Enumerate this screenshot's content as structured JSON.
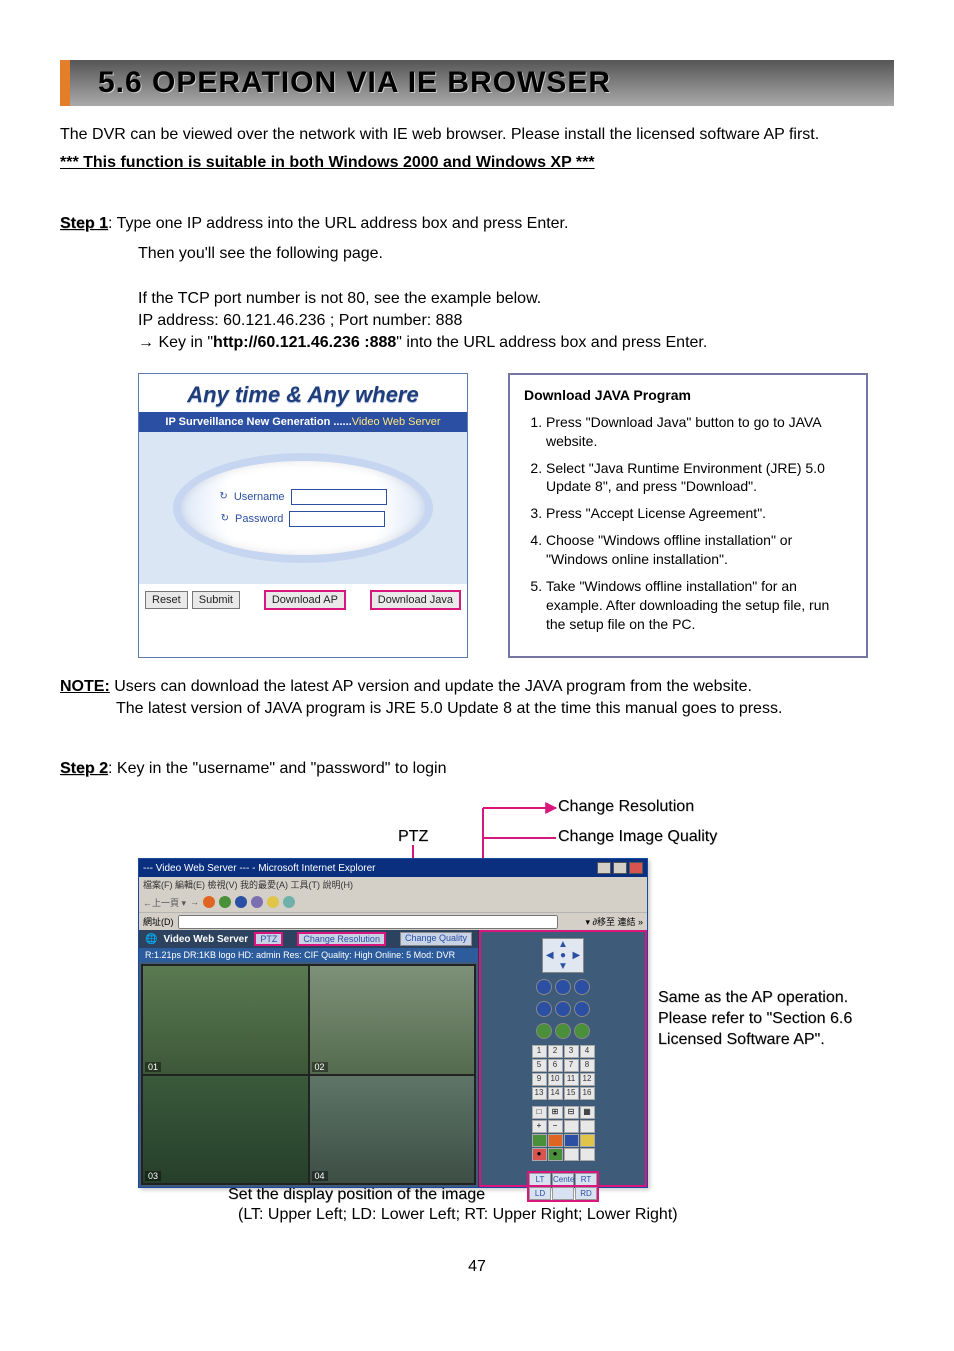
{
  "section": {
    "title": "5.6 OPERATION VIA IE BROWSER",
    "page_number": "47"
  },
  "intro": {
    "line1": "The DVR can be viewed over the network with IE web browser. Please install the licensed software AP first.",
    "bold_note": "*** This function is suitable in both Windows 2000 and Windows XP ***"
  },
  "step1": {
    "label": "Step 1",
    "body_rest": ": Type one IP address into the URL address box and press Enter.",
    "line2": "Then you'll see the following page.",
    "tcp_line": "If the TCP port number is not 80, see the example below.",
    "ip_line": "IP address: 60.121.46.236 ; Port number: 888",
    "keyin_lead": "→ Key in \"",
    "keyin_bold": "http://60.121.46.236  :888",
    "keyin_tail": "\" into the URL address box and press Enter."
  },
  "login_panel": {
    "header": "Any time & Any where",
    "subtitle_lead": "IP Surveillance New Generation ......",
    "subtitle_highlight": "Video Web Server",
    "username_label": "Username",
    "password_label": "Password",
    "buttons": {
      "reset": "Reset",
      "submit": "Submit",
      "download_ap": "Download AP",
      "download_java": "Download Java"
    }
  },
  "java_box": {
    "title": "Download JAVA Program",
    "items": [
      "Press \"Download Java\" button to go to JAVA website.",
      "Select \"Java Runtime Environment (JRE) 5.0 Update 8\", and press \"Download\".",
      "Press \"Accept License Agreement\".",
      "Choose \"Windows offline installation\" or \"Windows online installation\".",
      "Take \"Windows offline installation\" for an example. After downloading the setup file, run the setup file on the PC."
    ]
  },
  "note": {
    "label": "NOTE:",
    "line1": " Users can download the latest AP version and update the JAVA program from the website.",
    "line2": "The latest version of JAVA program is JRE 5.0 Update 8 at the time this manual goes to press."
  },
  "step2": {
    "label": "Step 2",
    "body_rest": ": Key in the \"username\" and \"password\" to login",
    "callouts": {
      "ptz": "PTZ",
      "change_res": "Change Resolution",
      "change_quality": "Change Image Quality",
      "ap_note": "Same as the AP operation. Please refer to \"Section 6.6 Licensed Software AP\".",
      "bottom_line": "Set the display position of the  image",
      "bottom_sub": "(LT: Upper Left; LD: Lower Left; RT: Upper Right; Lower Right)"
    },
    "ie": {
      "title": "--- Video Web Server --- - Microsoft Internet Explorer",
      "menu": "檔案(F)  編輯(E)  檢視(V)  我的最愛(A)  工具(T)  說明(H)",
      "dark_title": "Video Web Server",
      "status_bar": "R:1.21ps  DR:1KB logo HD: admin  Res: CIF Quality: High  Online: 5 Mod: DVR",
      "pills": {
        "ptz": "PTZ",
        "res": "Change Resolution",
        "quality": "Change Quality"
      },
      "quad_labels": [
        "01",
        "02",
        "03",
        "04"
      ],
      "corner_btns": {
        "lt": "LT",
        "center": "Center",
        "rt": "RT",
        "ld": "LD",
        "rd": "RD"
      },
      "addr_prefix": "網址(D)"
    }
  }
}
